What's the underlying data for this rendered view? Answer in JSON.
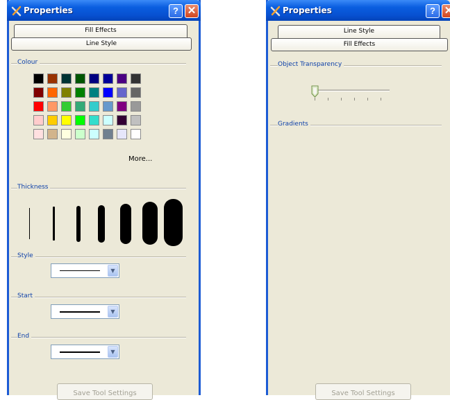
{
  "colors": {
    "titlebar": "#0a5ee0",
    "window_border": "#1c5bd4",
    "dialog_face": "#ece9d8",
    "group_label": "#0c3fa8"
  },
  "left_window": {
    "title": "Properties",
    "help_button": "?",
    "close_button": "✕",
    "tabs": {
      "back": "Fill Effects",
      "front": "Line Style"
    },
    "colour_group": {
      "label": "Colour",
      "swatches": [
        "#000000",
        "#993300",
        "#003333",
        "#005500",
        "#000080",
        "#000099",
        "#4b0082",
        "#333333",
        "#800000",
        "#ff6600",
        "#808000",
        "#008000",
        "#008080",
        "#0000ff",
        "#6666cc",
        "#666666",
        "#ff0000",
        "#ff9966",
        "#33cc33",
        "#33aa77",
        "#33cccc",
        "#6699cc",
        "#800080",
        "#999999",
        "#ffcccc",
        "#ffcc00",
        "#ffff00",
        "#00ff00",
        "#33ddcc",
        "#ccffff",
        "#330033",
        "#c0c0c0",
        "#ffe0e0",
        "#d2b48c",
        "#ffffe0",
        "#ccffcc",
        "#ccffff",
        "#708090",
        "#e6e6fa",
        "#ffffff"
      ],
      "more_label": "More..."
    },
    "thickness_group": {
      "label": "Thickness",
      "levels": [
        1,
        2,
        3,
        4,
        5,
        6,
        7
      ]
    },
    "style_group": {
      "label": "Style"
    },
    "start_group": {
      "label": "Start"
    },
    "end_group": {
      "label": "End"
    },
    "save_button": "Save Tool Settings"
  },
  "right_window": {
    "title": "Properties",
    "help_button": "?",
    "close_button": "✕",
    "tabs": {
      "back": "Line Style",
      "front": "Fill Effects"
    },
    "transparency_group": {
      "label": "Object Transparency",
      "value": 0
    },
    "gradients_group": {
      "label": "Gradients"
    },
    "save_button": "Save Tool Settings"
  }
}
